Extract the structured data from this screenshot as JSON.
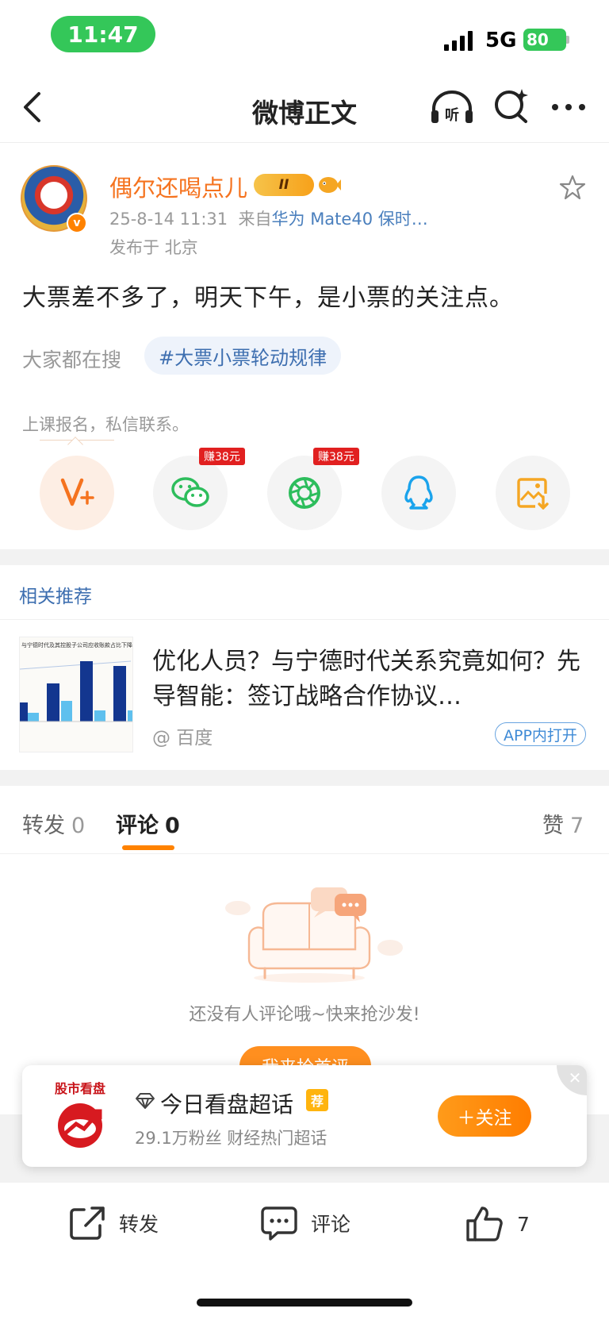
{
  "status_bar": {
    "time": "11:47",
    "network": "5G",
    "battery": "80"
  },
  "nav": {
    "title": "微博正文",
    "listen_label": "听"
  },
  "post": {
    "username": "偶尔还喝点儿",
    "vip_badge": "II",
    "verified_mark": "v",
    "timestamp": "25-8-14 11:31",
    "source_prefix": "来自",
    "source_device": "华为 Mate40 保时…",
    "location": "发布于 北京",
    "text": "大票差不多了，明天下午，是小票的关注点。",
    "search_label": "大家都在搜",
    "topic": "#大票小票轮动规律",
    "promo": "上课报名，私信联系。"
  },
  "share": {
    "items": [
      {
        "name": "vplus",
        "icon": "v-plus-icon"
      },
      {
        "name": "wechat",
        "icon": "wechat-icon",
        "earn": "赚38元"
      },
      {
        "name": "moments",
        "icon": "wechat-moments-icon",
        "earn": "赚38元"
      },
      {
        "name": "qq",
        "icon": "qq-icon"
      },
      {
        "name": "save-image",
        "icon": "save-image-icon"
      }
    ]
  },
  "recommend": {
    "title": "相关推荐",
    "headline": "优化人员？与宁德时代关系究竟如何？先导智能：签订战略合作协议…",
    "source": "@ 百度",
    "open_in_app": "APP内打开",
    "thumb_caption": "与宁德时代及其控股子公司应收账款占比下降"
  },
  "tabs": {
    "repost_label": "转发",
    "repost_count": "0",
    "comment_label": "评论",
    "comment_count": "0",
    "like_label": "赞",
    "like_count": "7"
  },
  "empty": {
    "message": "还没有人评论哦~快来抢沙发!",
    "button": "我来抢首评"
  },
  "supertopic": {
    "logo_text": "股市看盘",
    "title": "今日看盘超话",
    "tag": "荐",
    "subtitle": "29.1万粉丝  财经热门超话",
    "follow_label": "＋关注",
    "close": "✕"
  },
  "bottom_bar": {
    "repost": "转发",
    "comment": "评论",
    "like_count": "7"
  },
  "colors": {
    "accent": "#ff8200",
    "link": "#3e6fb0",
    "username": "#f5731f"
  }
}
